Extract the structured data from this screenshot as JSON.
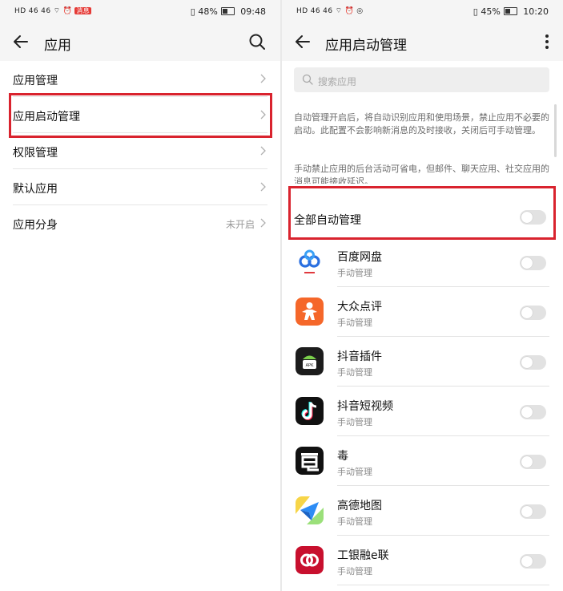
{
  "left": {
    "status": {
      "sig": [
        "HD",
        "46",
        "46",
        "⌔",
        "⏰"
      ],
      "alert": "消息",
      "battery": "48%",
      "time": "09:48"
    },
    "header": {
      "title": "应用"
    },
    "menu": [
      {
        "label": "应用管理",
        "value": ""
      },
      {
        "label": "应用启动管理",
        "value": ""
      },
      {
        "label": "权限管理",
        "value": ""
      },
      {
        "label": "默认应用",
        "value": ""
      },
      {
        "label": "应用分身",
        "value": "未开启"
      }
    ]
  },
  "right": {
    "status": {
      "sig": [
        "HD",
        "46",
        "46",
        "⌔",
        "⏰",
        "◎"
      ],
      "battery": "45%",
      "time": "10:20"
    },
    "header": {
      "title": "应用启动管理"
    },
    "search": {
      "placeholder": "搜索应用"
    },
    "desc1": "自动管理开启后，将自动识别应用和使用场景，禁止应用不必要的启动。此配置不会影响新消息的及时接收，关闭后可手动管理。",
    "desc2": "手动禁止应用的后台活动可省电，但邮件、聊天应用、社交应用的消息可能接收延迟。",
    "all_auto": {
      "label": "全部自动管理",
      "enabled": false
    },
    "apps": [
      {
        "name": "百度网盘",
        "mode": "手动管理",
        "icon": "baidu-netdisk-icon",
        "enabled": false
      },
      {
        "name": "大众点评",
        "mode": "手动管理",
        "icon": "dianping-icon",
        "enabled": false
      },
      {
        "name": "抖音插件",
        "mode": "手动管理",
        "icon": "apk-plugin-icon",
        "enabled": false
      },
      {
        "name": "抖音短视频",
        "mode": "手动管理",
        "icon": "douyin-icon",
        "enabled": false
      },
      {
        "name": "毒",
        "mode": "手动管理",
        "icon": "du-app-icon",
        "enabled": false
      },
      {
        "name": "高德地图",
        "mode": "手动管理",
        "icon": "amap-icon",
        "enabled": false
      },
      {
        "name": "工银融e联",
        "mode": "手动管理",
        "icon": "icbc-icon",
        "enabled": false
      }
    ]
  },
  "colors": {
    "highlight": "#d9232e",
    "toggle_off": "#e2e2e2",
    "header_bg": "#f5f5f5"
  }
}
